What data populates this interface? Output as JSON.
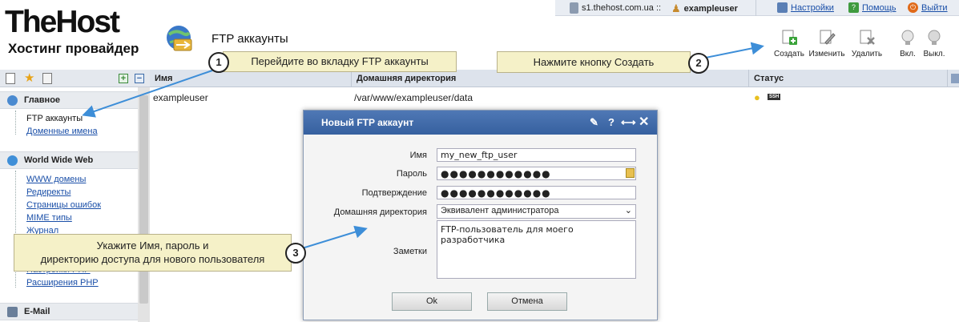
{
  "topbar": {
    "server": "s1.thehost.com.ua ::",
    "user": "exampleuser",
    "settings": "Настройки",
    "help": "Помощь",
    "logout": "Выйти"
  },
  "logo": {
    "main": "TheHost",
    "sub": "Хостинг провайдер"
  },
  "page_title": "FTP аккаунты",
  "toolbar": {
    "create": "Создать",
    "edit": "Изменить",
    "delete": "Удалить",
    "enable": "Вкл.",
    "disable": "Выкл."
  },
  "sidebar": {
    "sections": [
      {
        "title": "Главное",
        "items": [
          "FTP аккаунты",
          "Доменные имена"
        ]
      },
      {
        "title": "World Wide Web",
        "items": [
          "WWW домены",
          "Редиректы",
          "Страницы ошибок",
          "MIME типы",
          "Журнал",
          "Настройки PHP",
          "Расширения PHP"
        ]
      },
      {
        "title": "E-Mail",
        "items": []
      }
    ]
  },
  "table": {
    "columns": [
      "Имя",
      "Домашняя директория",
      "Статус"
    ],
    "rows": [
      {
        "name": "exampleuser",
        "home": "/var/www/exampleuser/data",
        "status_ssh": "SSH"
      }
    ]
  },
  "dialog": {
    "title": "Новый FTP аккаунт",
    "fields": {
      "name_label": "Имя",
      "name_value": "my_new_ftp_user",
      "password_label": "Пароль",
      "password_value": "●●●●●●●●●●●●",
      "confirm_label": "Подтверждение",
      "confirm_value": "●●●●●●●●●●●●",
      "home_label": "Домашняя директория",
      "home_value": "Эквивалент администратора",
      "notes_label": "Заметки",
      "notes_value": "FTP-пользователь для моего разработчика"
    },
    "ok": "Ok",
    "cancel": "Отмена"
  },
  "callouts": {
    "c1_num": "1",
    "c1_text": "Перейдите во вкладку FTP аккаунты",
    "c2_num": "2",
    "c2_text": "Нажмите кнопку Создать",
    "c3_num": "3",
    "c3_line1": "Укажите Имя, пароль и",
    "c3_line2": "директорию доступа для нового пользователя"
  },
  "colors": {
    "accent_blue": "#3a64a4",
    "callout_bg": "#f5f1c8",
    "arrow_blue": "#3d8ed8"
  }
}
